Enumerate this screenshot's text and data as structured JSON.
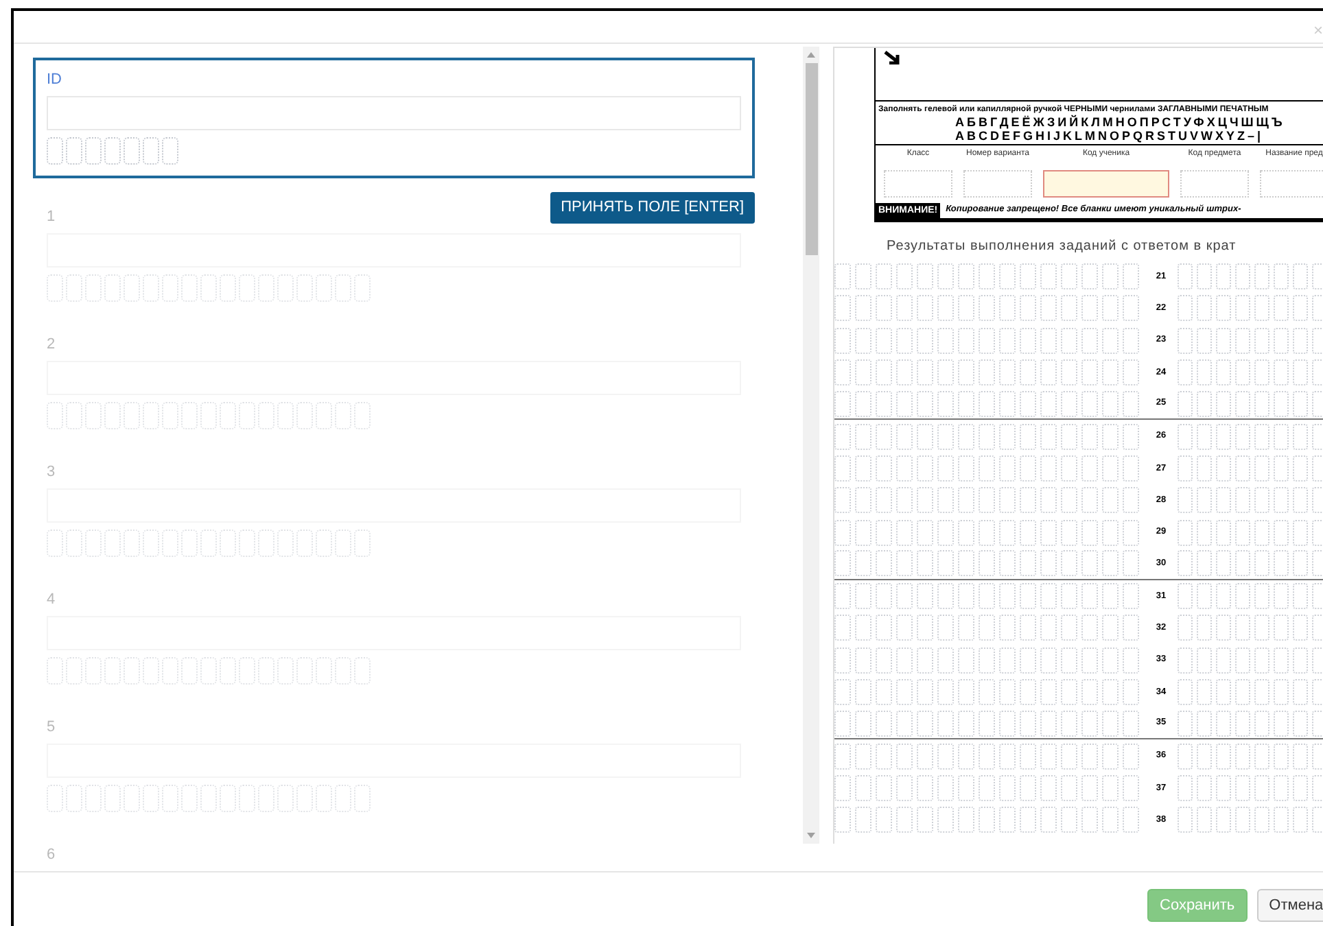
{
  "dialog": {
    "close": "×"
  },
  "fields": [
    {
      "label": "ID",
      "active": true
    },
    {
      "label": "1",
      "active": false
    },
    {
      "label": "2",
      "active": false
    },
    {
      "label": "3",
      "active": false
    },
    {
      "label": "4",
      "active": false
    },
    {
      "label": "5",
      "active": false
    },
    {
      "label": "6",
      "active": false
    }
  ],
  "accept_button": "ПРИНЯТЬ ПОЛЕ [ENTER]",
  "scan": {
    "instruction": "Заполнять гелевой или капиллярной ручкой ЧЕРНЫМИ чернилами ЗАГЛАВНЫМИ ПЕЧАТНЫМ",
    "alphabet_rows": [
      "АБВГДЕЁЖЗИЙКЛМНОПРСТУФХЦЧШЩЪ",
      "ABCDEFGHIJKLMNOPQRSTUVWXYZ–|"
    ],
    "code_fields": [
      {
        "label": "Класс",
        "highlighted": false
      },
      {
        "label": "Номер варианта",
        "highlighted": false
      },
      {
        "label": "Код ученика",
        "highlighted": true
      },
      {
        "label": "Код предмета",
        "highlighted": false
      },
      {
        "label": "Название пред",
        "highlighted": false
      }
    ],
    "warning_badge": "ВНИМАНИЕ!",
    "warning_text": "Копирование запрещено! Все бланки имеют уникальный штрих-",
    "title": "Результаты выполнения заданий с ответом в крат",
    "rows": [
      "21",
      "22",
      "23",
      "24",
      "25",
      "26",
      "27",
      "28",
      "29",
      "30",
      "31",
      "32",
      "33",
      "34",
      "35",
      "36",
      "37",
      "38"
    ]
  },
  "footer_buttons": [
    {
      "label": "Сохранить",
      "kind": "primary",
      "disabled": true
    },
    {
      "label": "Отмена",
      "kind": "secondary",
      "disabled": false
    }
  ]
}
